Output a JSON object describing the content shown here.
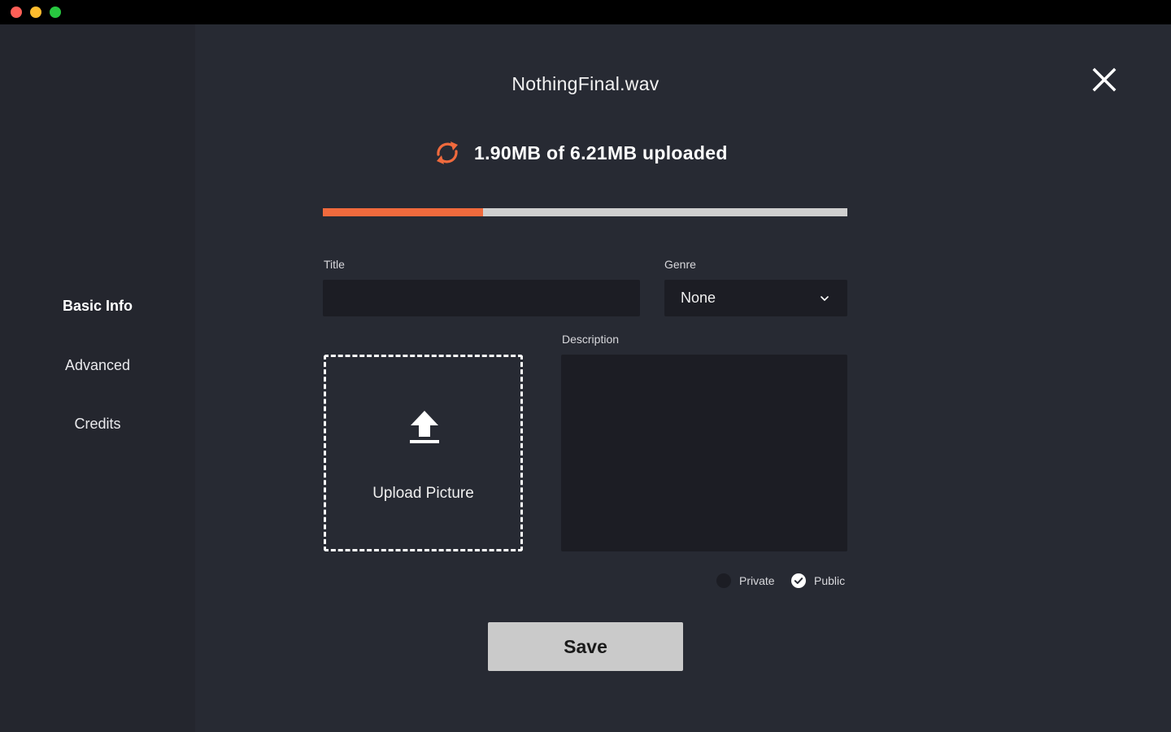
{
  "app": {
    "file_name": "NothingFinal.wav"
  },
  "sidebar": {
    "items": [
      {
        "label": "Basic Info",
        "active": true
      },
      {
        "label": "Advanced",
        "active": false
      },
      {
        "label": "Credits",
        "active": false
      }
    ]
  },
  "upload": {
    "status_text": "1.90MB of 6.21MB uploaded",
    "uploaded_mb": 1.9,
    "total_mb": 6.21,
    "progress_fraction": 0.306,
    "icon": "sync-icon",
    "accent_color": "#f06a3d"
  },
  "form": {
    "title_label": "Title",
    "title_value": "",
    "genre_label": "Genre",
    "genre_value": "None",
    "description_label": "Description",
    "description_value": "",
    "upload_picture_label": "Upload Picture",
    "visibility": {
      "private_label": "Private",
      "public_label": "Public",
      "selected": "Public"
    },
    "save_label": "Save"
  },
  "colors": {
    "window_bg": "#272a33",
    "sidebar_bg": "#24262e",
    "input_bg": "#1c1d24",
    "progress_track": "#cfcfcf",
    "button_bg": "#cacaca"
  }
}
